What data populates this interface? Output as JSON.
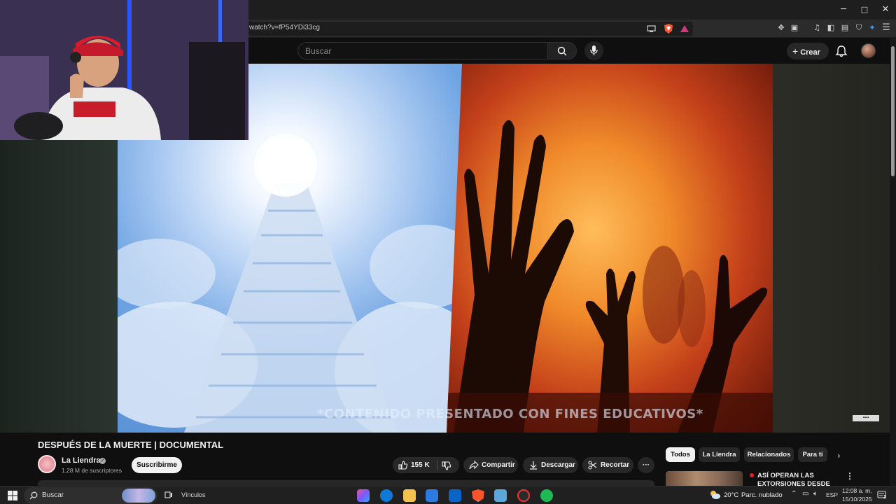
{
  "browser": {
    "url": "watch?v=fP54YDi33cg",
    "window_controls": {
      "minimize": "─",
      "maximize": "□",
      "close": "✕"
    }
  },
  "header": {
    "search_placeholder": "Buscar",
    "create_label": "Crear"
  },
  "video": {
    "overlay_caption": "*CONTENIDO PRESENTADO CON FINES EDUCATIVOS*",
    "title": "DESPUÉS DE LA MUERTE | DOCUMENTAL"
  },
  "channel": {
    "name": "La Liendra",
    "subscribers": "1,28 M de suscriptores",
    "subscribe_label": "Suscribirme"
  },
  "actions": {
    "likes": "155 K",
    "share": "Compartir",
    "download": "Descargar",
    "clip": "Recortar",
    "more": "···"
  },
  "chips": [
    "Todos",
    "La Liendra",
    "Relacionados",
    "Para ti"
  ],
  "recommendation": {
    "title": "ASÍ OPERAN LAS EXTORSIONES DESDE LA",
    "more": "⋮"
  },
  "taskbar": {
    "search_label": "Buscar",
    "links_label": "Vínculos",
    "temperature": "20°C",
    "weather": "Parc. nublado",
    "language": "ESP",
    "time": "12:08 a. m.",
    "date": "15/10/2025",
    "notifications": "2"
  },
  "colors": {
    "youtube_bg": "#0f0f0f",
    "pill_bg": "#272727",
    "spotify": "#1db954",
    "edge": "#0c7ad6"
  }
}
